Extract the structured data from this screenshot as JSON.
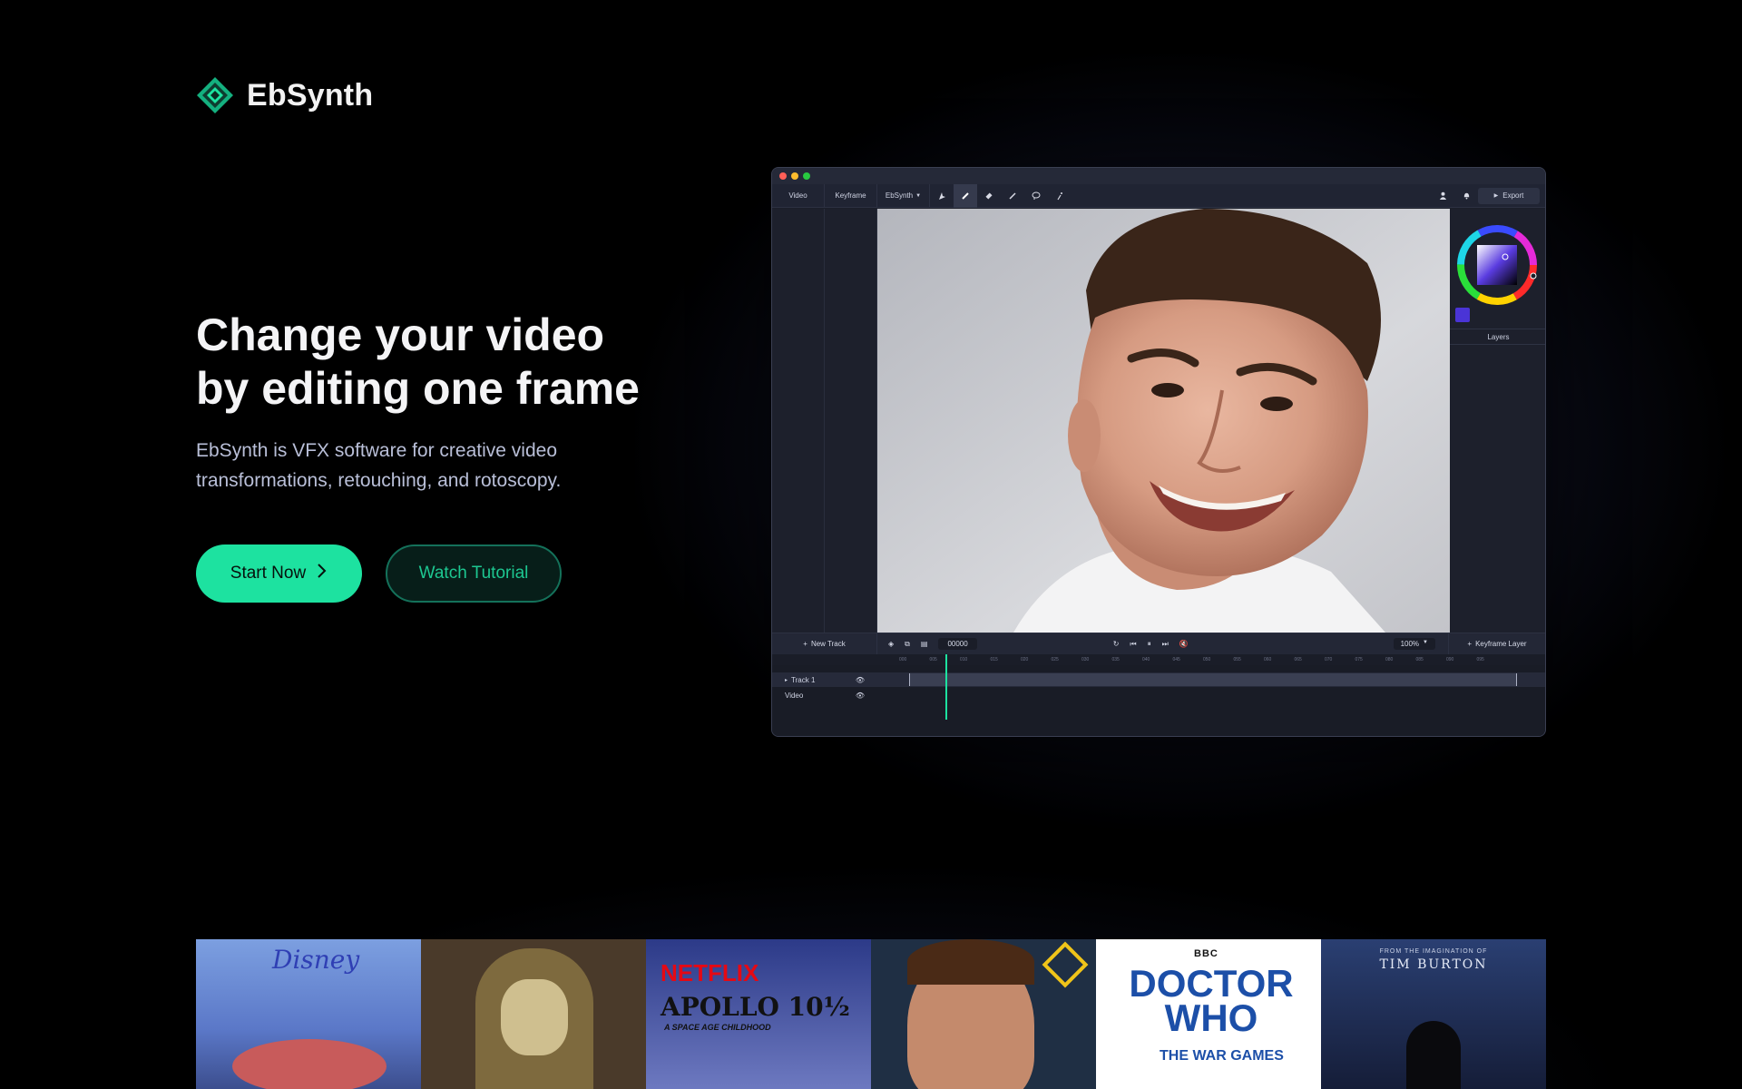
{
  "brand": {
    "name": "EbSynth",
    "accent": "#1de2a0"
  },
  "hero": {
    "title_line1": "Change your video",
    "title_line2": "by editing one frame",
    "subtitle": "EbSynth is VFX software for creative video transformations, retouching, and rotoscopy.",
    "primary_button": "Start Now",
    "secondary_button": "Watch Tutorial"
  },
  "app": {
    "tabs": [
      "Video",
      "Keyframe",
      "EbSynth"
    ],
    "tools": [
      "pointer-icon",
      "brush-icon",
      "eraser-icon",
      "pen-icon",
      "lasso-icon",
      "magic-icon"
    ],
    "export_label": "Export",
    "layers_label": "Layers",
    "new_track_label": "New Track",
    "frame_counter": "00000",
    "zoom": "100%",
    "keyframe_layer_label": "Keyframe Layer",
    "ruler_ticks": [
      "000",
      "005",
      "010",
      "015",
      "020",
      "025",
      "030",
      "035",
      "040",
      "045",
      "050",
      "055",
      "060",
      "065",
      "070",
      "075",
      "080",
      "085",
      "090",
      "095"
    ],
    "tracks": [
      {
        "label": "Track 1"
      },
      {
        "label": "Video"
      }
    ]
  },
  "posters": [
    {
      "name": "disney",
      "label": "Disney"
    },
    {
      "name": "monk",
      "label": ""
    },
    {
      "name": "apollo",
      "label": "NETFLIX",
      "title": "APOLLO 10½",
      "subtitle": "A SPACE AGE CHILDHOOD"
    },
    {
      "name": "spiderman",
      "label": ""
    },
    {
      "name": "doctor-who",
      "label": "BBC",
      "title": "DOCTOR WHO",
      "subtitle": "THE WAR GAMES"
    },
    {
      "name": "wednesday",
      "label": "FROM THE IMAGINATION OF",
      "title": "TIM BURTON"
    }
  ]
}
